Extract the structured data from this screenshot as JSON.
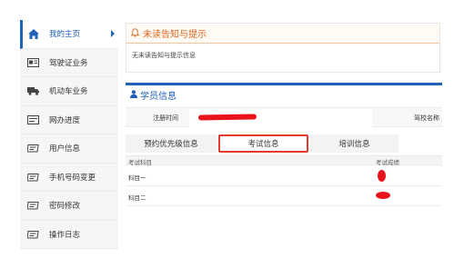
{
  "sidebar": {
    "items": [
      {
        "label": "我的主页",
        "icon": "home-icon",
        "active": true
      },
      {
        "label": "驾驶证业务",
        "icon": "license-card-icon"
      },
      {
        "label": "机动车业务",
        "icon": "truck-icon"
      },
      {
        "label": "网办进度",
        "icon": "progress-card-icon"
      },
      {
        "label": "用户信息",
        "icon": "user-card-icon"
      },
      {
        "label": "手机号码变更",
        "icon": "phone-card-icon"
      },
      {
        "label": "密码修改",
        "icon": "password-card-icon"
      },
      {
        "label": "操作日志",
        "icon": "log-card-icon"
      }
    ]
  },
  "notice": {
    "title": "未读告知与提示",
    "message": "无未读告知与提示信息",
    "icon": "bell-icon"
  },
  "student": {
    "title": "学员信息",
    "icon": "user-icon",
    "reg_time_label": "注册时间",
    "school_label": "驾校名称",
    "tabs": [
      "预约优先级信息",
      "考试信息",
      "培训信息"
    ],
    "active_tab": "考试信息",
    "table": {
      "headers": [
        "考试科目",
        "考试成绩"
      ],
      "rows": [
        {
          "subject": "科目一"
        },
        {
          "subject": "科目二"
        }
      ]
    }
  },
  "colors": {
    "accent_blue": "#1f62b8",
    "notice_orange": "#d9651c",
    "highlight_red": "#e23a2c",
    "redaction_red": "#e8131b"
  }
}
